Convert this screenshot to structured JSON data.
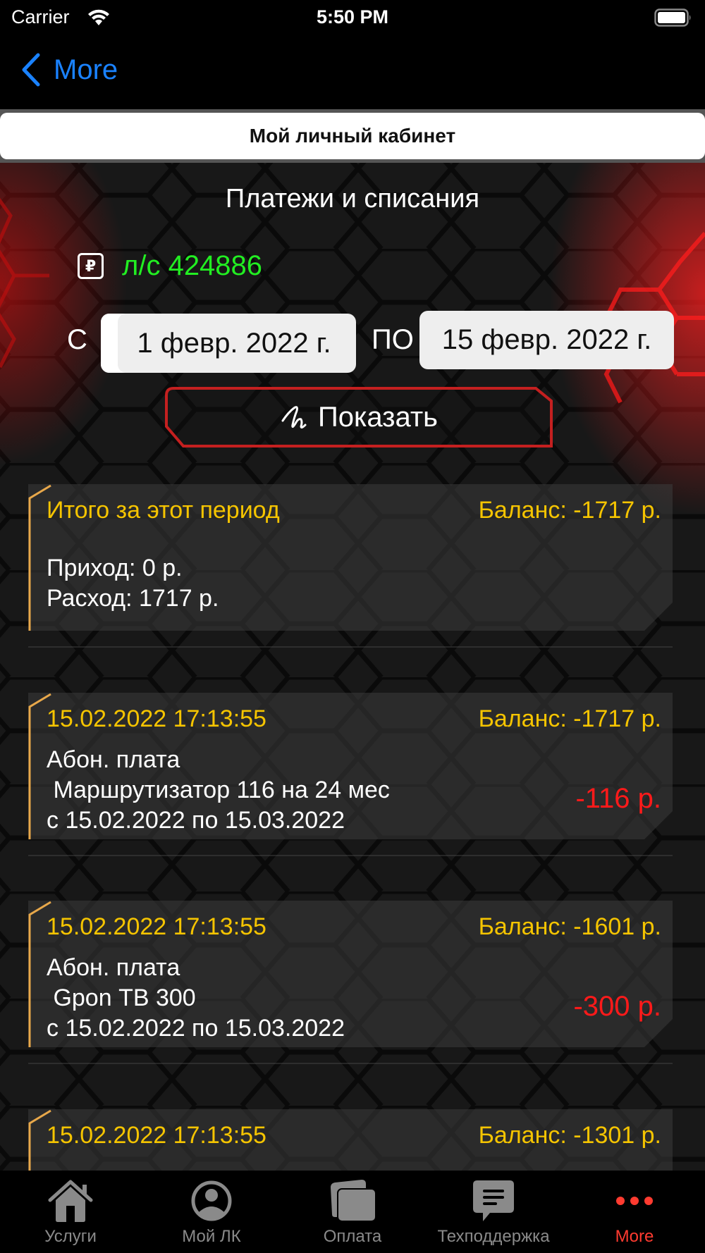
{
  "status_bar": {
    "carrier": "Carrier",
    "time": "5:50 PM"
  },
  "nav": {
    "back_label": "More"
  },
  "segment": {
    "title": "Мой личный кабинет"
  },
  "page": {
    "title": "Платежи и списания",
    "account_label": "л/с 424886",
    "from_label": "С",
    "to_label": "ПО",
    "date_from": "1 февр. 2022 г.",
    "date_to": "15 февр. 2022 г.",
    "show_button": "Показать"
  },
  "summary": {
    "title": "Итого за этот период",
    "balance": "Баланс: -1717 р.",
    "lines": "Приход: 0 р.\nРасход: 1717 р."
  },
  "transactions": [
    {
      "datetime": "15.02.2022 17:13:55",
      "balance": "Баланс: -1717 р.",
      "lines": "Абон. плата\n Маршрутизатор 116 на 24 мес\nс 15.02.2022 по 15.03.2022",
      "amount": "-116 р."
    },
    {
      "datetime": "15.02.2022 17:13:55",
      "balance": "Баланс: -1601 р.",
      "lines": "Абон. плата\n Gpon ТВ 300\nс 15.02.2022 по 15.03.2022",
      "amount": "-300 р."
    },
    {
      "datetime": "15.02.2022 17:13:55",
      "balance": "Баланс: -1301 р.",
      "lines": "",
      "amount": ""
    }
  ],
  "tabs": [
    {
      "label": "Услуги",
      "icon": "house-icon",
      "active": false
    },
    {
      "label": "Мой ЛК",
      "icon": "person-circle-icon",
      "active": false
    },
    {
      "label": "Оплата",
      "icon": "cards-icon",
      "active": false
    },
    {
      "label": "Техподдержка",
      "icon": "chat-bubble-icon",
      "active": false
    },
    {
      "label": "More",
      "icon": "more-dots-icon",
      "active": true
    }
  ],
  "colors": {
    "accent_blue": "#1a82ff",
    "account_green": "#22ee22",
    "header_yellow": "#f5c400",
    "amount_red": "#ff1a1a",
    "tab_active": "#ff3b30",
    "tab_inactive": "#8a8a8a",
    "card_accent": "#e8a84a"
  }
}
